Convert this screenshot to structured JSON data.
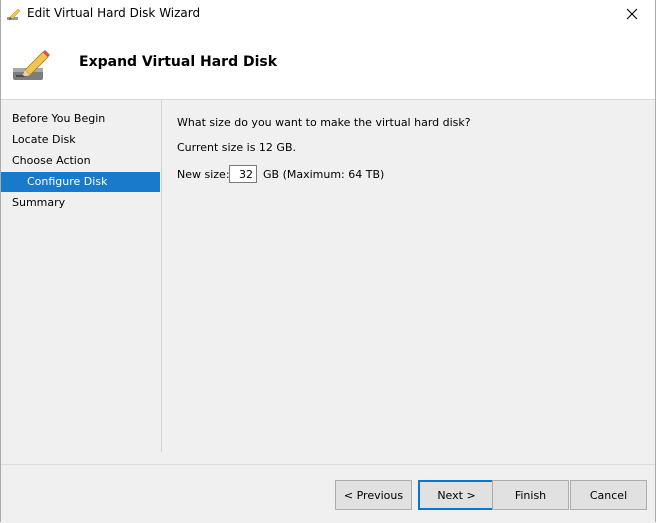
{
  "window": {
    "title": "Edit Virtual Hard Disk Wizard",
    "title_icon": "wizard-pencil-icon",
    "close_icon": "close-icon"
  },
  "header": {
    "title": "Expand Virtual Hard Disk",
    "icon": "disk-pencil-icon"
  },
  "sidebar": {
    "items": [
      {
        "label": "Before You Begin",
        "active": false
      },
      {
        "label": "Locate Disk",
        "active": false
      },
      {
        "label": "Choose Action",
        "active": false
      },
      {
        "label": "Configure Disk",
        "active": true
      },
      {
        "label": "Summary",
        "active": false
      }
    ]
  },
  "main": {
    "question": "What size do you want to make the virtual hard disk?",
    "current_size": "Current size is 12 GB.",
    "new_size_label": "New size:",
    "new_size_value": "32",
    "unit_note": "GB (Maximum: 64 TB)"
  },
  "footer": {
    "previous_label": "< Previous",
    "next_label": "Next >",
    "finish_label": "Finish",
    "cancel_label": "Cancel"
  },
  "colors": {
    "accent": "#1979ca",
    "default_button_border": "#0078d7",
    "panel_bg": "#f0f0f0"
  }
}
